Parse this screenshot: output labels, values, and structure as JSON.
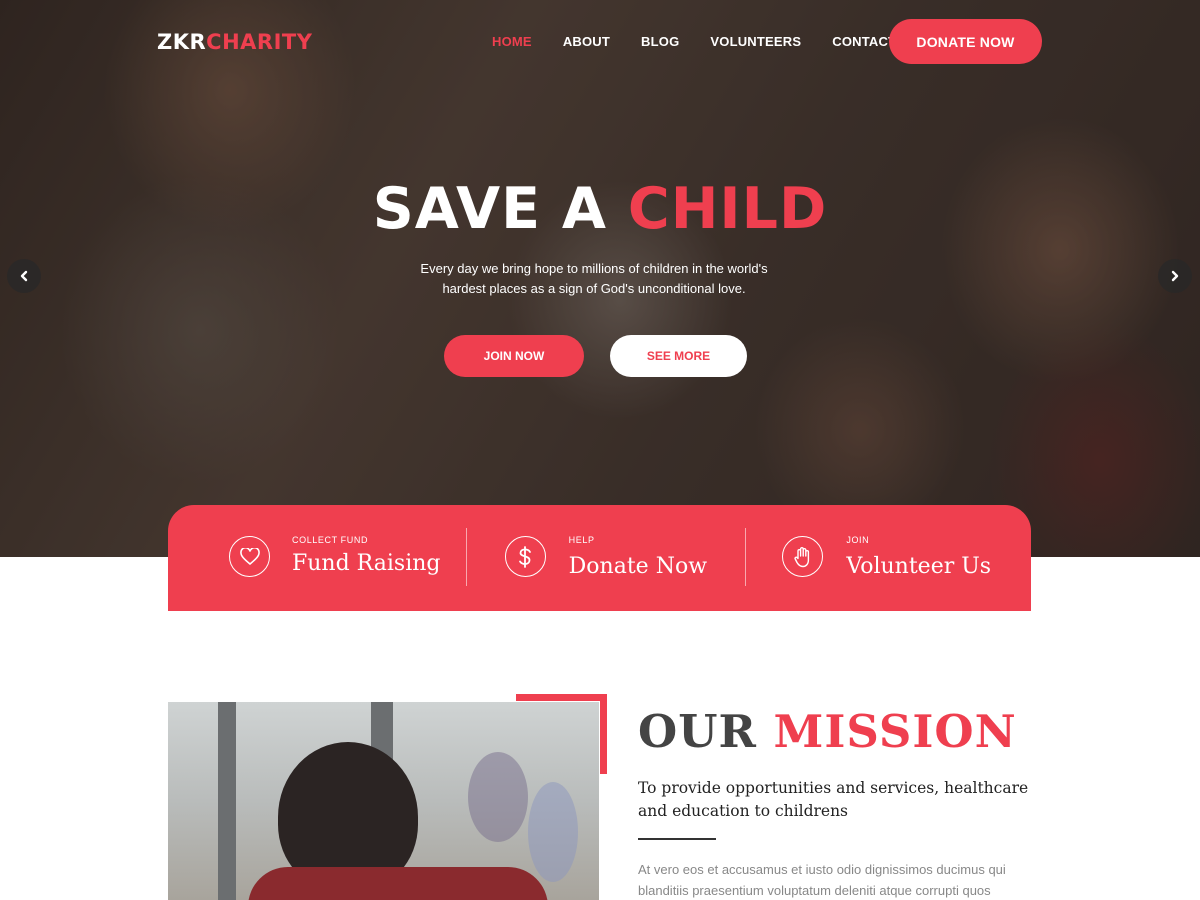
{
  "logo": {
    "part1": "ZKR",
    "part2": "CHARITY"
  },
  "nav": {
    "items": [
      {
        "label": "HOME",
        "active": true
      },
      {
        "label": "ABOUT"
      },
      {
        "label": "BLOG"
      },
      {
        "label": "VOLUNTEERS"
      },
      {
        "label": "CONTACT"
      }
    ],
    "donate_label": "DONATE NOW"
  },
  "hero": {
    "title_white": "SAVE A",
    "title_red": "CHILD",
    "subtitle": "Every day we bring hope to millions of children in the world's hardest places as a sign of God's unconditional love.",
    "join_label": "JOIN NOW",
    "see_more_label": "SEE MORE",
    "prev_icon": "chevron-left-icon",
    "next_icon": "chevron-right-icon"
  },
  "features": [
    {
      "small": "COLLECT FUND",
      "big": "Fund Raising",
      "icon": "heart-icon"
    },
    {
      "small": "HELP",
      "big": "Donate Now",
      "icon": "dollar-icon"
    },
    {
      "small": "JOIN",
      "big": "Volunteer Us",
      "icon": "hand-icon"
    }
  ],
  "mission": {
    "title_gray": "OUR",
    "title_red": "MISSION",
    "lead": "To provide opportunities and services, healthcare and education to childrens",
    "body": "At vero eos et accusamus et iusto odio dignissimos ducimus qui blanditiis praesentium voluptatum deleniti atque corrupti quos"
  },
  "colors": {
    "accent": "#ef3f4f",
    "heading_gray": "#444444",
    "body_gray": "#888888"
  }
}
